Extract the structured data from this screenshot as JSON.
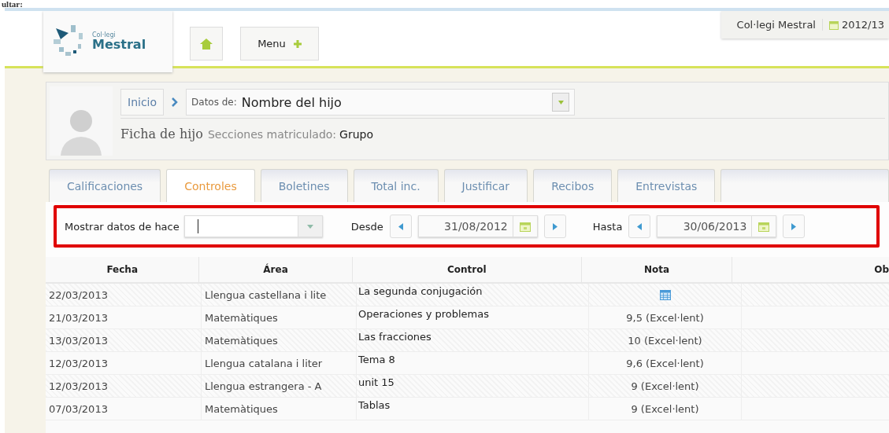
{
  "page_caption": "ultar:",
  "header": {
    "logo": {
      "small": "Col·legi",
      "name": "Mestral"
    },
    "menu_button": "Menu",
    "school": "Col·legi Mestral",
    "year": "2012/13"
  },
  "profile": {
    "breadcrumb": "Inicio",
    "selector_label": "Datos de:",
    "selector_value": "Nombre del hijo",
    "title": "Ficha de hijo",
    "sections_label": "Secciones matriculado:",
    "sections_value": "Grupo"
  },
  "tabs": [
    {
      "label": "Calificaciones",
      "selected": false
    },
    {
      "label": "Controles",
      "selected": true
    },
    {
      "label": "Boletines",
      "selected": false
    },
    {
      "label": "Total inc.",
      "selected": false
    },
    {
      "label": "Justificar",
      "selected": false
    },
    {
      "label": "Recibos",
      "selected": false
    },
    {
      "label": "Entrevistas",
      "selected": false
    }
  ],
  "filter_bar": {
    "highlighted": true,
    "period_label": "Mostrar datos de hace",
    "from_label": "Desde",
    "from_date": "31/08/2012",
    "to_label": "Hasta",
    "to_date": "30/06/2013"
  },
  "table": {
    "columns": [
      "Fecha",
      "Área",
      "Control",
      "Nota",
      "Ob"
    ],
    "rows": [
      {
        "fecha": "22/03/2013",
        "area": "Llengua castellana i lite",
        "control": "La segunda conjugación",
        "nota": {
          "kind": "icon"
        }
      },
      {
        "fecha": "21/03/2013",
        "area": "Matemàtiques",
        "control": "Operaciones y problemas",
        "nota": {
          "kind": "text",
          "text": "9,5 (Excel·lent)"
        }
      },
      {
        "fecha": "13/03/2013",
        "area": "Matemàtiques",
        "control": "Las fracciones",
        "nota": {
          "kind": "text",
          "text": "10 (Excel·lent)"
        }
      },
      {
        "fecha": "12/03/2013",
        "area": "Llengua catalana i liter",
        "control": "Tema 8",
        "nota": {
          "kind": "text",
          "text": "9,6 (Excel·lent)"
        }
      },
      {
        "fecha": "12/03/2013",
        "area": "Llengua estrangera - A",
        "control": "unit 15",
        "nota": {
          "kind": "text",
          "text": "9 (Excel·lent)"
        }
      },
      {
        "fecha": "07/03/2013",
        "area": "Matemàtiques",
        "control": "Tablas",
        "nota": {
          "kind": "text",
          "text": "9 (Excel·lent)"
        }
      }
    ]
  }
}
